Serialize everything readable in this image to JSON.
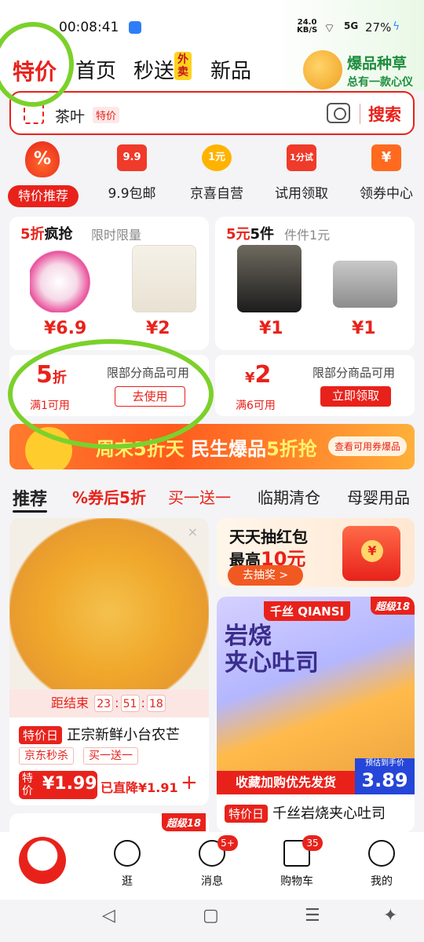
{
  "status": {
    "time": "00:08:41",
    "net_speed": "24.0",
    "net_unit": "KB/S",
    "signal": "5G",
    "battery": "27%"
  },
  "top_tabs": [
    "特价",
    "首页",
    "秒送",
    "新品"
  ],
  "waimai_badge": "外卖",
  "promo": {
    "title": "爆品种草",
    "subtitle": "总有一款心仪"
  },
  "search": {
    "query": "茶叶",
    "tag": "特价",
    "button": "搜索"
  },
  "categories": [
    {
      "label": "特价推荐",
      "icon": "flame-percent-icon",
      "glyph": "%"
    },
    {
      "label": "9.9包邮",
      "icon": "nine-nine-icon",
      "glyph": "9.9",
      "color": "#f03a2a"
    },
    {
      "label": "京喜自营",
      "icon": "one-yuan-badge-icon",
      "glyph": "1元",
      "color": "#ffb300"
    },
    {
      "label": "试用领取",
      "icon": "trial-gift-icon",
      "glyph": "1分试",
      "color": "#f03a2a"
    },
    {
      "label": "领券中心",
      "icon": "coupon-yen-icon",
      "glyph": "¥",
      "color": "#ff6a1e"
    }
  ],
  "deals": {
    "left": {
      "head_red": "5折",
      "head_black": "疯抢",
      "sub": "限时限量",
      "prices": [
        "¥6.9",
        "¥2"
      ]
    },
    "right": {
      "head_red": "5元",
      "head_black": "5件",
      "sub": "件件1元",
      "prices": [
        "¥1",
        "¥1"
      ]
    }
  },
  "coupons": {
    "left": {
      "amount": "5",
      "unit": "折",
      "condition": "满1可用",
      "desc": "限部分商品可用",
      "button": "去使用"
    },
    "right": {
      "amount": "2",
      "unit": "¥",
      "condition": "满6可用",
      "desc": "限部分商品可用",
      "button": "立即领取"
    }
  },
  "banner": {
    "title_a": "周末5折天",
    "title_b": "民生爆品",
    "title_c": "5折抢",
    "button": "查看可用券爆品"
  },
  "rec_tabs": [
    "推荐",
    "券后5折",
    "买一送一",
    "临期清仓",
    "母婴用品"
  ],
  "feed": {
    "mango": {
      "countdown_label": "距结束",
      "h": "23",
      "m": "51",
      "s": "18",
      "badge": "特价日",
      "title": "正宗新鲜小台农芒",
      "tags": [
        "京东秒杀",
        "买一送一"
      ],
      "price_label": "特价",
      "price": "¥1.99",
      "drop": "已直降¥1.91"
    },
    "red_packet": {
      "line1": "天天抽红包",
      "line2a": "最高",
      "line2b": "10元",
      "button": "去抽奖 >"
    },
    "toast": {
      "brand": "千丝 QIANSI",
      "super": "超级18",
      "headline_1": "岩烧",
      "headline_2": "夹心吐司",
      "bar": "收藏加购优先发货",
      "est_label": "预估到手价",
      "est_price": "3.89",
      "badge": "特价日",
      "title": "千丝岩烧夹心吐司"
    },
    "partial_super": "超级18"
  },
  "bottom_nav": [
    {
      "label": "逛",
      "icon": "stroll-icon"
    },
    {
      "label": "消息",
      "icon": "message-icon",
      "badge": "5+"
    },
    {
      "label": "购物车",
      "icon": "cart-icon",
      "badge": "35"
    },
    {
      "label": "我的",
      "icon": "profile-icon"
    }
  ],
  "colors": {
    "accent": "#e8221b",
    "annotation": "#7bd12b"
  }
}
